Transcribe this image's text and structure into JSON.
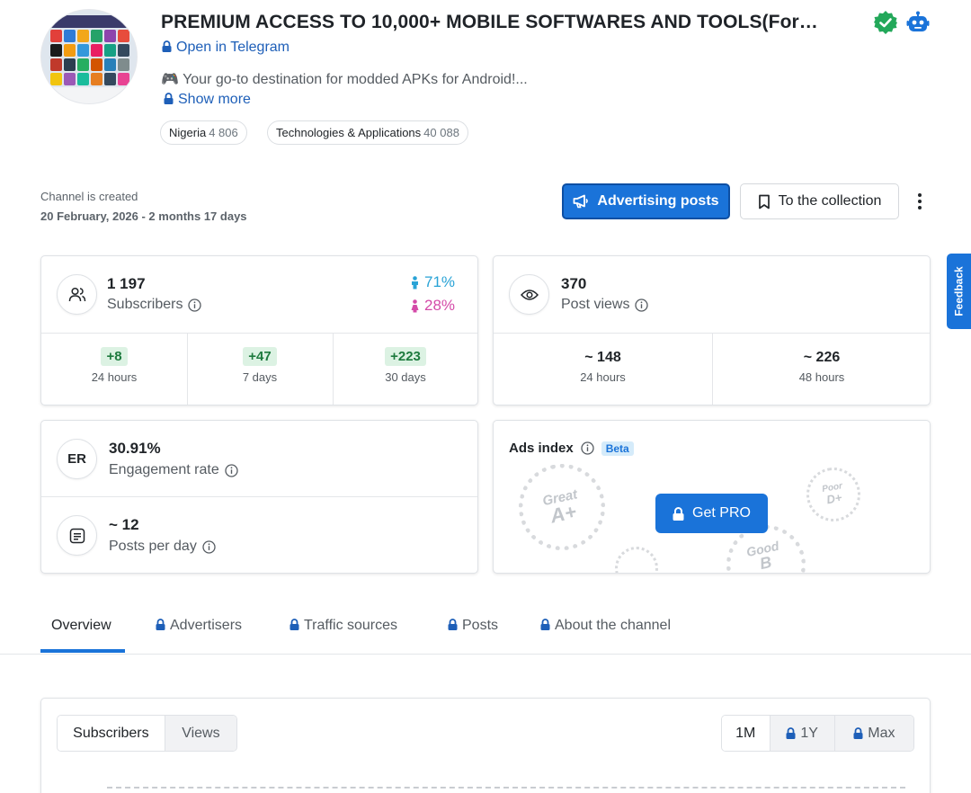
{
  "channel": {
    "title": "PREMIUM ACCESS TO 10,000+ MOBILE SOFTWARES AND TOOLS(For…",
    "open_link": "Open in Telegram",
    "description": "🎮 Your go-to destination for modded APKs for Android!...",
    "show_more": "Show more",
    "tags": [
      {
        "label": "Nigeria",
        "count": "4 806"
      },
      {
        "label": "Technologies & Applications",
        "count": "40 088"
      }
    ],
    "created_label": "Channel is created",
    "created_value": "20 February, 2026 - 2 months 17 days"
  },
  "actions": {
    "advertising": "Advertising posts",
    "collection": "To the collection"
  },
  "feedback": "Feedback",
  "subscribers": {
    "value": "1 197",
    "label": "Subscribers",
    "male_pct": "71%",
    "female_pct": "28%",
    "deltas": [
      {
        "value": "+8",
        "label": "24 hours"
      },
      {
        "value": "+47",
        "label": "7 days"
      },
      {
        "value": "+223",
        "label": "30 days"
      }
    ]
  },
  "views": {
    "value": "370",
    "label": "Post views",
    "periods": [
      {
        "value": "~ 148",
        "label": "24 hours"
      },
      {
        "value": "~ 226",
        "label": "48 hours"
      }
    ]
  },
  "engagement": {
    "icon_text": "ER",
    "value": "30.91%",
    "label": "Engagement rate",
    "posts_value": "~ 12",
    "posts_label": "Posts per day"
  },
  "ads_index": {
    "title": "Ads index",
    "beta": "Beta",
    "button": "Get PRO",
    "stamps": [
      {
        "word": "Great",
        "grade": "A+"
      },
      {
        "word": "Poor",
        "grade": "D+"
      },
      {
        "word": "Good",
        "grade": "B"
      }
    ]
  },
  "tabs": [
    "Overview",
    "Advertisers",
    "Traffic sources",
    "Posts",
    "About the channel"
  ],
  "chart": {
    "metrics": [
      "Subscribers",
      "Views"
    ],
    "ranges": [
      "1M",
      "1Y",
      "Max"
    ]
  },
  "colors": {
    "accent": "#1a73d9",
    "male": "#29a3d6",
    "female": "#d44aa8",
    "positive": "#1d7a3e",
    "verified": "#23a85a"
  }
}
